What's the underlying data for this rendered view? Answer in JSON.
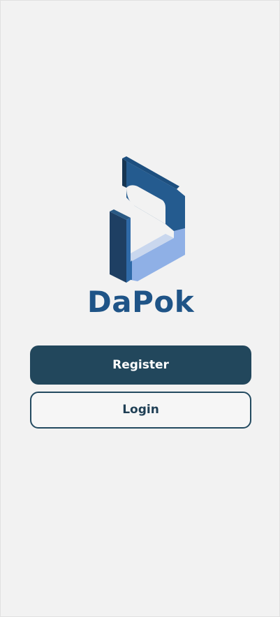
{
  "app": {
    "brand_name": "DaPok"
  },
  "actions": {
    "register_label": "Register",
    "login_label": "Login"
  },
  "colors": {
    "background": "#f2f2f2",
    "brand_blue": "#1f5487",
    "logo_light_blue": "#8fb0e6",
    "logo_dark": "#1e3f63",
    "register_button_bg": "#22475c",
    "login_button_border": "#234a60"
  },
  "icons": {
    "logo": "dapok-d-logo-icon"
  }
}
